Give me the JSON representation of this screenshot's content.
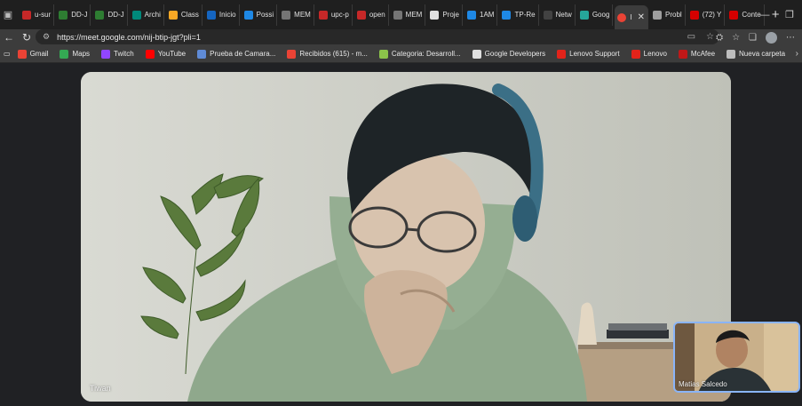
{
  "tabs": [
    {
      "label": "u-sur",
      "color": "#c62828"
    },
    {
      "label": "DD-J",
      "color": "#2e7d32"
    },
    {
      "label": "DD-J",
      "color": "#2e7d32"
    },
    {
      "label": "Archi",
      "color": "#00897b"
    },
    {
      "label": "Class",
      "color": "#f9a825"
    },
    {
      "label": "Inicio",
      "color": "#1565c0"
    },
    {
      "label": "Possi",
      "color": "#1e88e5"
    },
    {
      "label": "MEM",
      "color": "#757575"
    },
    {
      "label": "upc-p",
      "color": "#c62828"
    },
    {
      "label": "open",
      "color": "#c62828"
    },
    {
      "label": "MEM",
      "color": "#757575"
    },
    {
      "label": "Proje",
      "color": "#e0e0e0"
    },
    {
      "label": "1AM",
      "color": "#1e88e5"
    },
    {
      "label": "TP-Re",
      "color": "#1e88e5"
    },
    {
      "label": "Netw",
      "color": "#424242"
    },
    {
      "label": "Goog",
      "color": "#26a69a"
    }
  ],
  "active_tab": {
    "label": "I",
    "close": "✕"
  },
  "tabs_after": [
    {
      "label": "Probl",
      "color": "#9e9e9e"
    },
    {
      "label": "(72) Y",
      "color": "#d50000"
    },
    {
      "label": "Conte",
      "color": "#d50000"
    }
  ],
  "new_tab": "+",
  "window_controls": {
    "minimize": "—",
    "restore": "❐",
    "close": "✕"
  },
  "address": {
    "url": "https://meet.google.com/nij-btip-jgt?pli=1"
  },
  "bookmarks": [
    {
      "label": "Gmail",
      "color": "#ea4335"
    },
    {
      "label": "Maps",
      "color": "#34a853"
    },
    {
      "label": "Twitch",
      "color": "#9146ff"
    },
    {
      "label": "YouTube",
      "color": "#ff0000"
    },
    {
      "label": "Prueba de Camara...",
      "color": "#5f8bd6"
    },
    {
      "label": "Recibidos (615) - m...",
      "color": "#ea4335"
    },
    {
      "label": "Categoria: Desarroll...",
      "color": "#8bc34a"
    },
    {
      "label": "Google Developers",
      "color": "#e0e0e0"
    },
    {
      "label": "Lenovo Support",
      "color": "#e2231a"
    },
    {
      "label": "Lenovo",
      "color": "#e2231a"
    },
    {
      "label": "McAfee",
      "color": "#c01818"
    },
    {
      "label": "Nueva carpeta",
      "color": "#bdbdbd"
    }
  ],
  "meeting": {
    "main_participant": "Tiwan",
    "pip_participant": "Matias Salcedo"
  },
  "colors": {
    "accent": "#8ab4f8",
    "background": "#202124"
  }
}
